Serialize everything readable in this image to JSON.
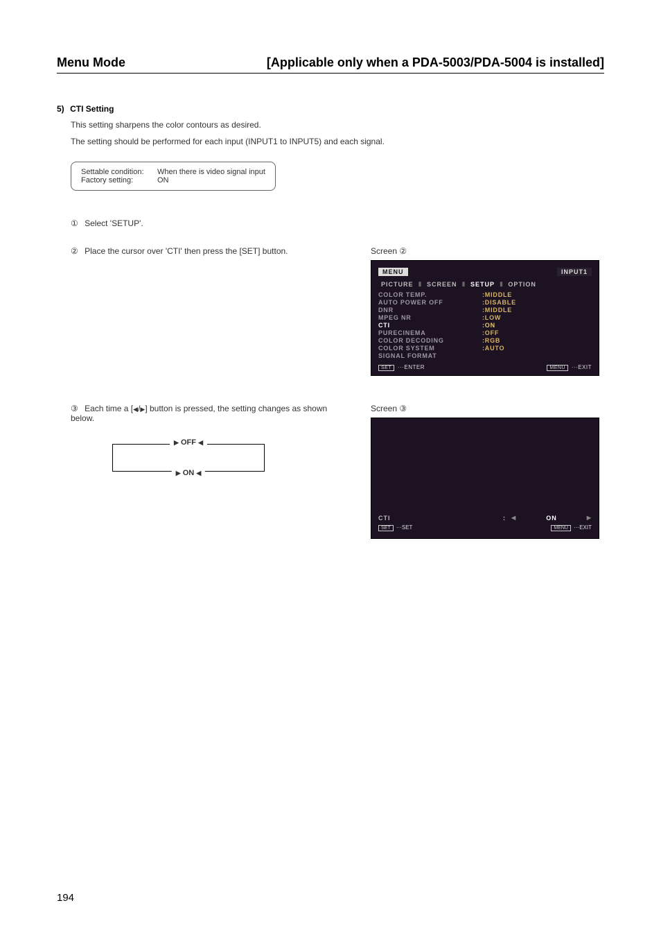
{
  "header": {
    "left": "Menu Mode",
    "right": "[Applicable only when a PDA-5003/PDA-5004 is installed]"
  },
  "section": {
    "num": "5)",
    "title": "CTI Setting",
    "p1": "This setting sharpens the color contours as desired.",
    "p2": "The setting should be performed for each input (INPUT1 to INPUT5) and each signal."
  },
  "cond": {
    "r1l": "Settable condition:",
    "r1v": "When there is video signal input",
    "r2l": "Factory setting:",
    "r2v": "ON"
  },
  "steps": {
    "s1_num": "①",
    "s1": "Select 'SETUP'.",
    "s2_num": "②",
    "s2": "Place the cursor over 'CTI' then press the [SET] button.",
    "s3_num": "③",
    "s3a": "Each time a [",
    "s3b": "] button is pressed, the setting changes as shown below."
  },
  "screen2": {
    "label": "Screen ②",
    "menu": "MENU",
    "input": "INPUT1",
    "tabs": {
      "t1": "PICTURE",
      "t2": "SCREEN",
      "t3": "SETUP",
      "t4": "OPTION"
    },
    "rows": [
      {
        "k": "COLOR TEMP.",
        "v": ":MIDDLE"
      },
      {
        "k": "AUTO POWER OFF",
        "v": ":DISABLE"
      },
      {
        "k": "DNR",
        "v": ":MIDDLE"
      },
      {
        "k": "MPEG NR",
        "v": ":LOW"
      },
      {
        "k": "CTI",
        "v": ":ON",
        "hl": true
      },
      {
        "k": "PURECINEMA",
        "v": ":OFF"
      },
      {
        "k": "COLOR DECODING",
        "v": ":RGB"
      },
      {
        "k": "COLOR SYSTEM",
        "v": ":AUTO"
      },
      {
        "k": "SIGNAL FORMAT",
        "v": ""
      }
    ],
    "footer": {
      "l_btn": "SET",
      "l_txt": "···ENTER",
      "r_btn": "MENU",
      "r_txt": "···EXIT"
    }
  },
  "screen3": {
    "label": "Screen ③",
    "k": "CTI",
    "colon": ":",
    "val": "ON",
    "footer": {
      "l_btn": "SET",
      "l_txt": "···SET",
      "r_btn": "MENU",
      "r_txt": "···EXIT"
    }
  },
  "cycle": {
    "off": "OFF",
    "on": "ON"
  },
  "page": "194"
}
